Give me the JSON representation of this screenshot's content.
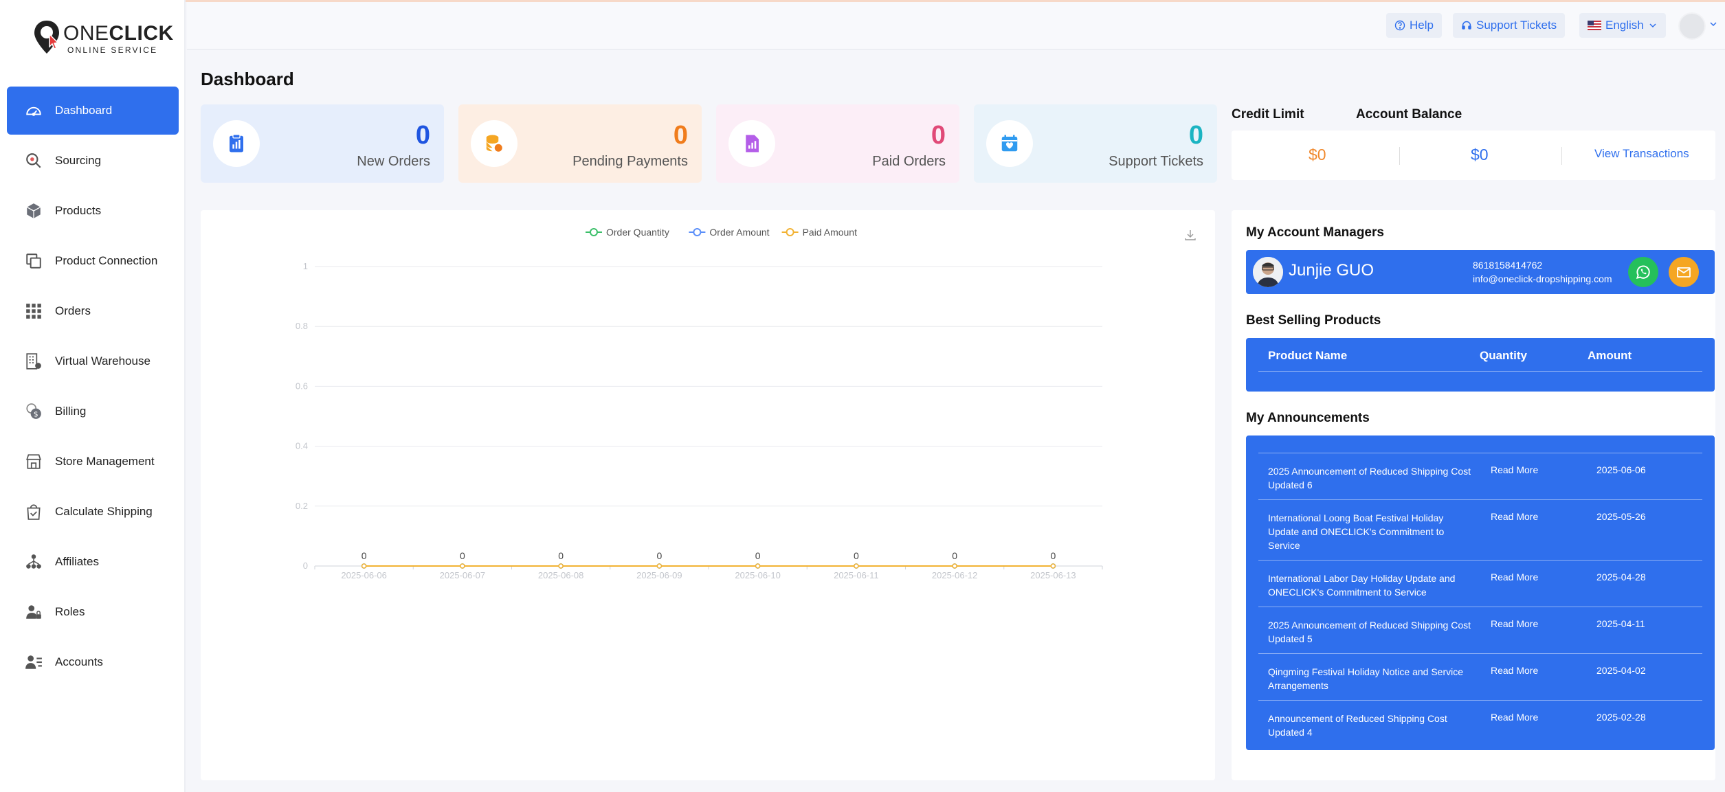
{
  "brand": {
    "name_light": "ONE",
    "name_bold": "CLICK",
    "tagline": "ONLINE SERVICE"
  },
  "sidebar": {
    "items": [
      {
        "label": "Dashboard",
        "icon": "gauge-icon",
        "active": true
      },
      {
        "label": "Sourcing",
        "icon": "search-icon"
      },
      {
        "label": "Products",
        "icon": "box-icon"
      },
      {
        "label": "Product Connection",
        "icon": "link-icon"
      },
      {
        "label": "Orders",
        "icon": "grid-icon"
      },
      {
        "label": "Virtual Warehouse",
        "icon": "building-icon"
      },
      {
        "label": "Billing",
        "icon": "coin-icon"
      },
      {
        "label": "Store Management",
        "icon": "store-icon"
      },
      {
        "label": "Calculate Shipping",
        "icon": "bag-check-icon"
      },
      {
        "label": "Affiliates",
        "icon": "network-icon"
      },
      {
        "label": "Roles",
        "icon": "user-lock-icon"
      },
      {
        "label": "Accounts",
        "icon": "user-list-icon"
      }
    ]
  },
  "header": {
    "help": "Help",
    "support": "Support Tickets",
    "language": "English"
  },
  "page": {
    "title": "Dashboard"
  },
  "stats": [
    {
      "value": "0",
      "label": "New Orders",
      "color": "#1f55e0",
      "bg": "#e6eefc",
      "icon_color": "#2f6fed",
      "icon": "clipboard-chart-icon"
    },
    {
      "value": "0",
      "label": "Pending Payments",
      "color": "#f07c1c",
      "bg": "#fdeee3",
      "icon_color": "#f5a623",
      "icon": "coins-icon"
    },
    {
      "value": "0",
      "label": "Paid Orders",
      "color": "#e04a78",
      "bg": "#fceef7",
      "icon_color": "#b45ee8",
      "icon": "document-chart-icon"
    },
    {
      "value": "0",
      "label": "Support Tickets",
      "color": "#1bb4c2",
      "bg": "#e9f3fa",
      "icon_color": "#2f9bf0",
      "icon": "calendar-heart-icon"
    }
  ],
  "credit": {
    "credit_limit_label": "Credit Limit",
    "account_balance_label": "Account Balance",
    "credit_value": "$0",
    "balance_value": "$0",
    "view_transactions": "View Transactions",
    "credit_color": "#f0892d",
    "balance_color": "#2f6fed"
  },
  "chart_data": {
    "type": "line",
    "x": [
      "2025-06-06",
      "2025-06-07",
      "2025-06-08",
      "2025-06-09",
      "2025-06-10",
      "2025-06-11",
      "2025-06-12",
      "2025-06-13"
    ],
    "series": [
      {
        "name": "Order Quantity",
        "values": [
          0,
          0,
          0,
          0,
          0,
          0,
          0,
          0
        ],
        "color": "#3cbf6a"
      },
      {
        "name": "Order Amount",
        "values": [
          0,
          0,
          0,
          0,
          0,
          0,
          0,
          0
        ],
        "color": "#5b8ff9"
      },
      {
        "name": "Paid Amount",
        "values": [
          0,
          0,
          0,
          0,
          0,
          0,
          0,
          0
        ],
        "color": "#f2b233"
      }
    ],
    "y_ticks": [
      "0",
      "0.2",
      "0.4",
      "0.6",
      "0.8",
      "1"
    ],
    "ylim": [
      0,
      1
    ],
    "grid": true,
    "legend": "top-center",
    "data_labels": [
      "0",
      "0",
      "0",
      "0",
      "0",
      "0",
      "0",
      "0"
    ]
  },
  "managers": {
    "title": "My Account Managers",
    "name": "Junjie GUO",
    "phone": "8618158414762",
    "email": "info@oneclick-dropshipping.com"
  },
  "best_selling": {
    "title": "Best Selling Products",
    "col_name": "Product Name",
    "col_qty": "Quantity",
    "col_amount": "Amount"
  },
  "announcements": {
    "title": "My Announcements",
    "items": [
      {
        "title": "2025 Announcement of Reduced Shipping Cost Updated 6",
        "link": "Read More",
        "date": "2025-06-06"
      },
      {
        "title": "International Loong Boat Festival Holiday Update and ONECLICK's Commitment to Service",
        "link": "Read More",
        "date": "2025-05-26"
      },
      {
        "title": "International Labor Day Holiday Update and ONECLICK's Commitment to Service",
        "link": "Read More",
        "date": "2025-04-28"
      },
      {
        "title": "2025 Announcement of Reduced Shipping Cost Updated 5",
        "link": "Read More",
        "date": "2025-04-11"
      },
      {
        "title": "Qingming Festival Holiday Notice and Service Arrangements",
        "link": "Read More",
        "date": "2025-04-02"
      },
      {
        "title": "Announcement of Reduced Shipping Cost Updated 4",
        "link": "Read More",
        "date": "2025-02-28"
      }
    ]
  }
}
